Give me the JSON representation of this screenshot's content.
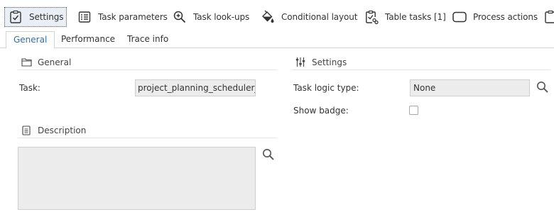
{
  "toolbar": {
    "items": [
      {
        "label": "Settings",
        "icon": "checklist-icon"
      },
      {
        "label": "Task parameters",
        "icon": "table-list-icon"
      },
      {
        "label": "Task look-ups",
        "icon": "zoom-in-icon"
      },
      {
        "label": "Conditional layout",
        "icon": "paint-bucket-icon"
      },
      {
        "label": "Table tasks [1]",
        "icon": "checklist-link-icon"
      },
      {
        "label": "Process actions",
        "icon": "rounded-rect-icon"
      }
    ]
  },
  "tabs": [
    {
      "label": "General"
    },
    {
      "label": "Performance"
    },
    {
      "label": "Trace info"
    }
  ],
  "general_section": {
    "title": "General",
    "task_label": "Task:",
    "task_value": "project_planning_scheduler_operations"
  },
  "description_section": {
    "title": "Description",
    "value": ""
  },
  "settings_section": {
    "title": "Settings",
    "logic_type_label": "Task logic type:",
    "logic_type_value": "None",
    "show_badge_label": "Show badge:",
    "show_badge_checked": false
  }
}
